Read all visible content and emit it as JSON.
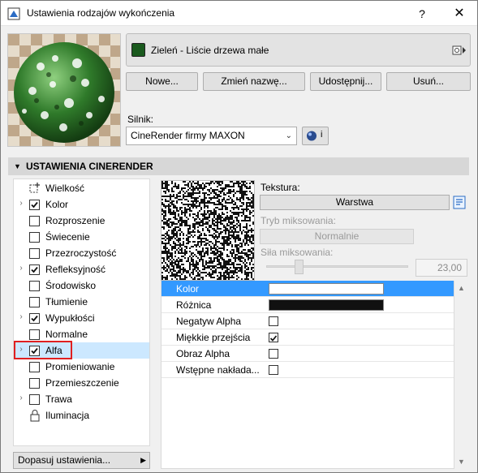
{
  "window": {
    "title": "Ustawienia rodzajów wykończenia",
    "help_label": "?",
    "close_label": "✕"
  },
  "surface": {
    "name": "Zieleń - Liście drzewa małe",
    "color": "#1a5a1e"
  },
  "buttons": {
    "new": "Nowe...",
    "rename": "Zmień nazwę...",
    "share": "Udostępnij...",
    "delete": "Usuń..."
  },
  "engine": {
    "label": "Silnik:",
    "value": "CineRender firmy MAXON",
    "info_label": "i"
  },
  "section": {
    "title": "USTAWIENIA CINERENDER"
  },
  "channels": [
    {
      "label": "Wielkość",
      "kind": "icon",
      "icon": "resize-icon",
      "expander": false,
      "checked": false,
      "selected": false
    },
    {
      "label": "Kolor",
      "kind": "check",
      "expander": true,
      "checked": true,
      "selected": false
    },
    {
      "label": "Rozproszenie",
      "kind": "check",
      "expander": false,
      "checked": false,
      "selected": false
    },
    {
      "label": "Świecenie",
      "kind": "check",
      "expander": false,
      "checked": false,
      "selected": false
    },
    {
      "label": "Przezroczystość",
      "kind": "check",
      "expander": false,
      "checked": false,
      "selected": false
    },
    {
      "label": "Refleksyjność",
      "kind": "check",
      "expander": true,
      "checked": true,
      "selected": false
    },
    {
      "label": "Środowisko",
      "kind": "check",
      "expander": false,
      "checked": false,
      "selected": false
    },
    {
      "label": "Tłumienie",
      "kind": "check",
      "expander": false,
      "checked": false,
      "selected": false
    },
    {
      "label": "Wypukłości",
      "kind": "check",
      "expander": true,
      "checked": true,
      "selected": false
    },
    {
      "label": "Normalne",
      "kind": "check",
      "expander": false,
      "checked": false,
      "selected": false
    },
    {
      "label": "Alfa",
      "kind": "check",
      "expander": true,
      "checked": true,
      "selected": true
    },
    {
      "label": "Promieniowanie",
      "kind": "check",
      "expander": false,
      "checked": false,
      "selected": false
    },
    {
      "label": "Przemieszczenie",
      "kind": "check",
      "expander": false,
      "checked": false,
      "selected": false
    },
    {
      "label": "Trawa",
      "kind": "check",
      "expander": true,
      "checked": false,
      "selected": false
    },
    {
      "label": "Iluminacja",
      "kind": "icon",
      "icon": "lock-icon",
      "expander": false,
      "checked": false,
      "selected": false
    }
  ],
  "adjust_button": "Dopasuj ustawienia...",
  "texture": {
    "label": "Tekstura:",
    "value": "Warstwa"
  },
  "blend": {
    "mode_label": "Tryb miksowania:",
    "mode_value": "Normalnie",
    "strength_label": "Siła miksowania:",
    "strength_value": "23,00",
    "strength_fraction": 0.23
  },
  "properties": [
    {
      "name": "Kolor",
      "type": "color",
      "color": "#ffffff",
      "selected": true
    },
    {
      "name": "Różnica",
      "type": "color",
      "color": "#111111",
      "selected": false
    },
    {
      "name": "Negatyw Alpha",
      "type": "check",
      "checked": false,
      "selected": false
    },
    {
      "name": "Miękkie przejścia",
      "type": "check",
      "checked": true,
      "selected": false
    },
    {
      "name": "Obraz Alpha",
      "type": "check",
      "checked": false,
      "selected": false
    },
    {
      "name": "Wstępne nakłada...",
      "type": "check",
      "checked": false,
      "selected": false
    }
  ]
}
